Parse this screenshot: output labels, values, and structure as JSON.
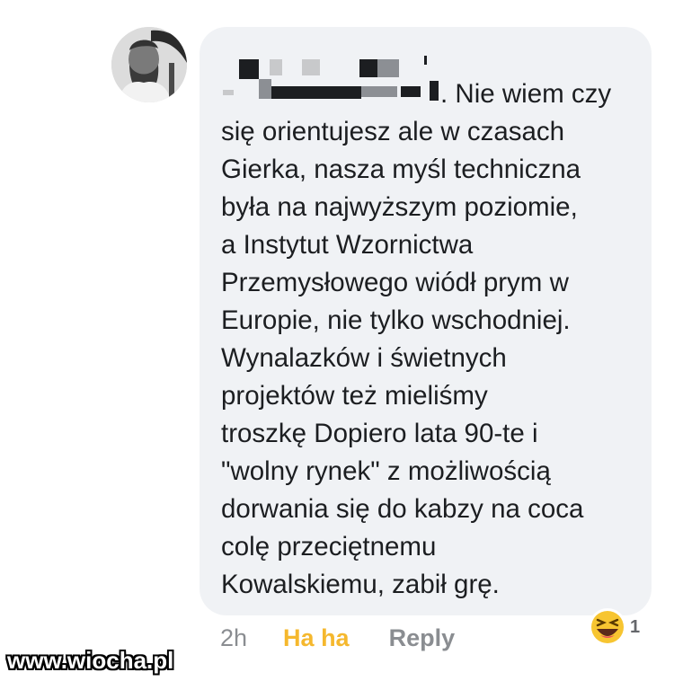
{
  "comment": {
    "lines": [
      ". Nie wiem czy",
      "się orientujesz ale w czasach",
      "Gierka, nasza myśl techniczna",
      "była na najwyższym poziomie,",
      "a Instytut Wzornictwa",
      "Przemysłowego wiódł prym w",
      "Europie, nie tylko wschodniej.",
      "Wynalazków i świetnych",
      "projektów też mieliśmy",
      "troszkę Dopiero lata 90-te i",
      "\"wolny rynek\" z możliwością",
      "dorwania się do kabzy na coca",
      "colę przeciętnemu",
      "Kowalskiemu, zabił grę."
    ]
  },
  "actions": {
    "time": "2h",
    "haha": "Ha ha",
    "reply": "Reply"
  },
  "reaction": {
    "icon": "haha-emoji-icon",
    "count": "1"
  },
  "watermark": "www.wiocha.pl",
  "colors": {
    "bubble": "#f0f2f5",
    "haha": "#f5b82e",
    "muted": "#8a8d91",
    "text": "#1c1e21"
  }
}
